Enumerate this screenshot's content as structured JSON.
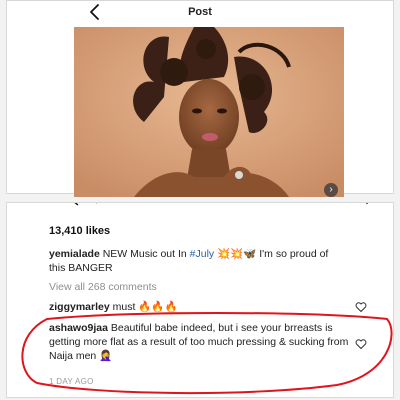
{
  "header": {
    "title": "Post"
  },
  "post": {
    "likes": "13,410 likes",
    "caption": {
      "user": "yemialade",
      "text_before": " NEW Music out In ",
      "hashtag": "#July",
      "text_after": " 💥💥🦋 I'm so proud of this BANGER"
    },
    "view_all": "View all 268 comments",
    "comments": [
      {
        "user": "ziggymarley",
        "text": " must 🔥🔥🔥"
      },
      {
        "user": "ashawo9jaa",
        "text": " Beautiful babe indeed, but i see your brreasts is getting more flat as a result of too much pressing & sucking from Naija men 🤦‍♀️"
      }
    ],
    "timestamp": "1 DAY AGO"
  },
  "colors": {
    "highlight": "#e0141c",
    "hashtag": "#2d5fa0",
    "muted": "#8e8e8e"
  }
}
